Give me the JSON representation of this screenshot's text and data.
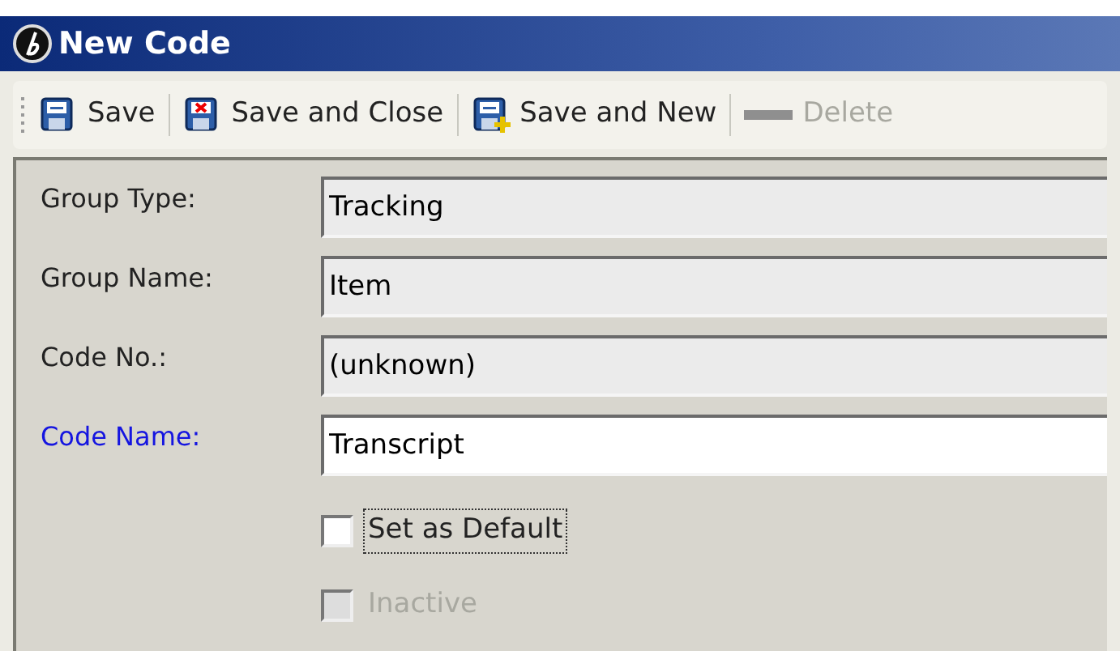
{
  "window": {
    "title": "New Code"
  },
  "toolbar": [
    {
      "kind": "save",
      "label": "Save",
      "disabled": false
    },
    {
      "kind": "save_close",
      "label": "Save and Close",
      "disabled": false
    },
    {
      "kind": "save_new",
      "label": "Save and New",
      "disabled": false
    },
    {
      "kind": "delete",
      "label": "Delete",
      "disabled": true
    }
  ],
  "fields": [
    {
      "label": "Group Type:",
      "value": "Tracking",
      "required": false,
      "readonly": true
    },
    {
      "label": "Group Name:",
      "value": "Item",
      "required": false,
      "readonly": true
    },
    {
      "label": "Code No.:",
      "value": "(unknown)",
      "required": false,
      "readonly": true
    },
    {
      "label": "Code Name:",
      "value": "Transcript",
      "required": true,
      "readonly": false
    }
  ],
  "checkboxes": [
    {
      "label": "Set as Default",
      "checked": false,
      "disabled": false,
      "focused": true
    },
    {
      "label": "Inactive",
      "checked": false,
      "disabled": true,
      "focused": false
    }
  ]
}
